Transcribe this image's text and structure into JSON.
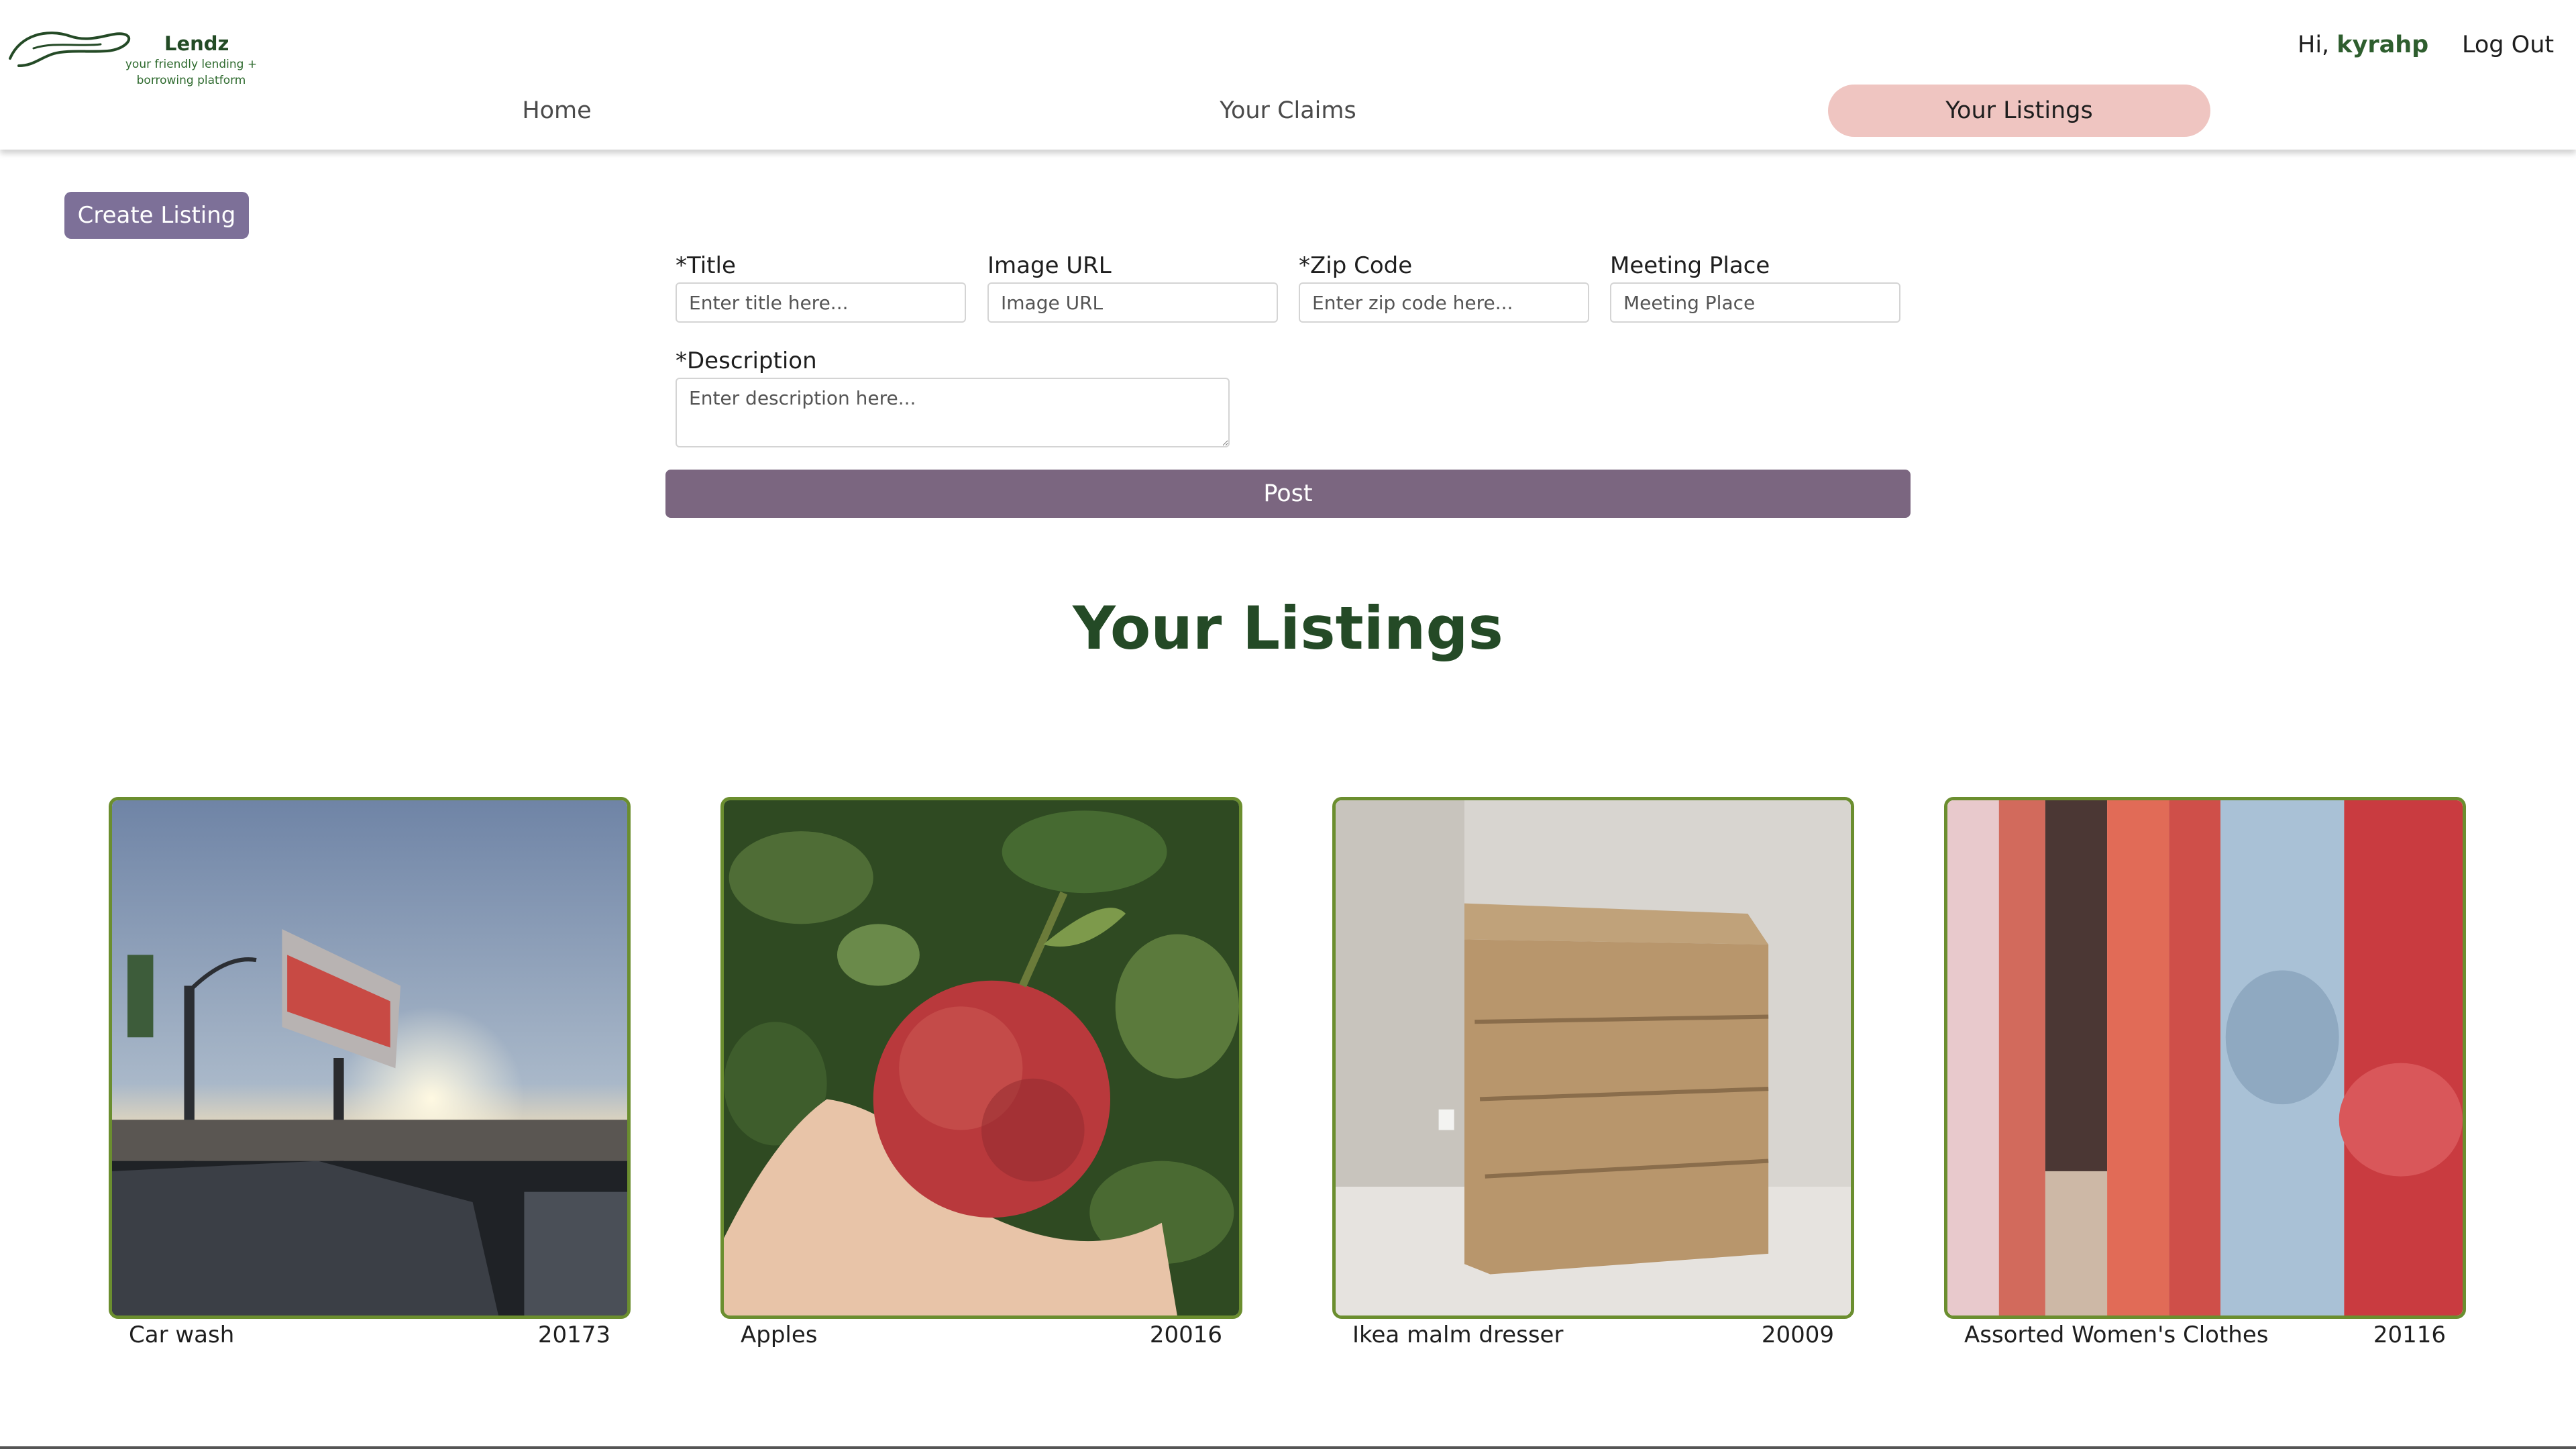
{
  "brand": {
    "name": "Lendz",
    "tagline_line1": "your friendly lending +",
    "tagline_line2": "borrowing platform"
  },
  "user": {
    "greeting": "Hi, ",
    "username": "kyrahp",
    "logout_label": "Log Out"
  },
  "nav": {
    "home": "Home",
    "claims": "Your Claims",
    "listings": "Your Listings",
    "active": "Your Listings"
  },
  "create_listing_label": "Create Listing",
  "form": {
    "title_label": "*Title",
    "title_placeholder": "Enter title here...",
    "image_label": "Image URL",
    "image_placeholder": "Image URL",
    "zip_label": "*Zip Code",
    "zip_placeholder": "Enter zip code here...",
    "meeting_label": "Meeting Place",
    "meeting_placeholder": "Meeting Place",
    "description_label": "*Description",
    "description_placeholder": "Enter description here...",
    "post_label": "Post"
  },
  "listings_heading": "Your Listings",
  "listings": [
    {
      "title": "Car wash",
      "zip": "20173",
      "image": "car-wash-photo"
    },
    {
      "title": "Apples",
      "zip": "20016",
      "image": "apple-photo"
    },
    {
      "title": "Ikea malm dresser",
      "zip": "20009",
      "image": "dresser-photo"
    },
    {
      "title": "Assorted Women's Clothes",
      "zip": "20116",
      "image": "clothes-photo"
    }
  ],
  "colors": {
    "brand_green": "#244a26",
    "active_tab": "#efc5c1",
    "create_button": "#7d7098",
    "post_button": "#7b6680",
    "card_border": "#6b8e2f"
  }
}
